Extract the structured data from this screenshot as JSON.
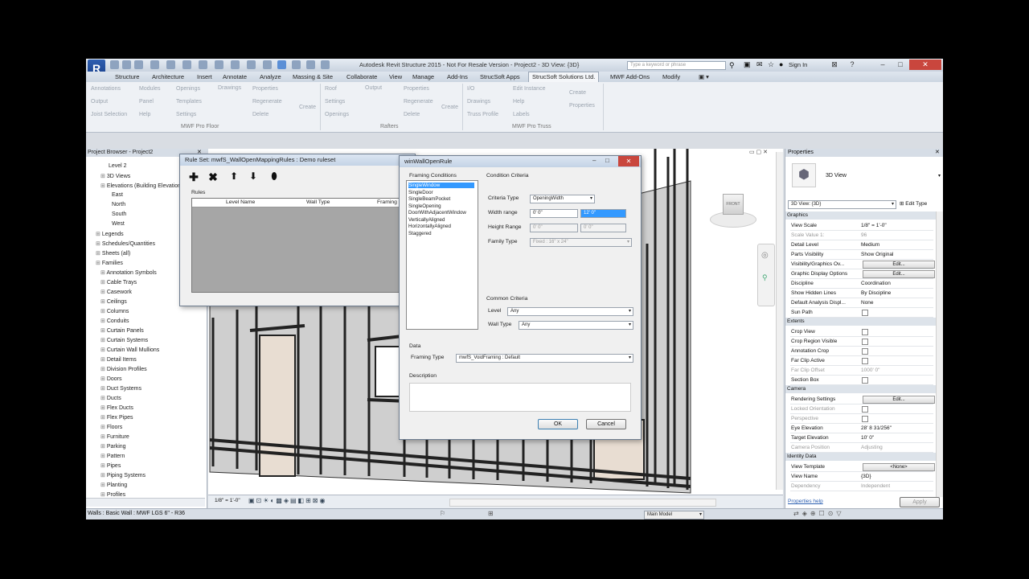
{
  "title_bar": {
    "app_title": "Autodesk Revit Structure 2015 - Not For Resale Version -   Project2 - 3D View: {3D}",
    "search_placeholder": "Type a keyword or phrase",
    "sign_in": "Sign In"
  },
  "tabs": [
    "Structure",
    "Architecture",
    "Insert",
    "Annotate",
    "Analyze",
    "Massing & Site",
    "Collaborate",
    "View",
    "Manage",
    "Add-Ins",
    "StrucSoft Apps",
    "StrucSoft Solutions Ltd.",
    "MWF Add-Ons",
    "Modify"
  ],
  "active_tab": "StrucSoft Solutions Ltd.",
  "ribbon": {
    "panels": [
      {
        "name": "MWF Pro Floor",
        "items": [
          "Annotations",
          "Modules",
          "Openings",
          "Drawings",
          "Output",
          "Panel",
          "Templates",
          "Joist Selection",
          "Help",
          "Settings",
          "Properties",
          "Regenerate",
          "Delete",
          "Create"
        ]
      },
      {
        "name": "Rafters",
        "items": [
          "Roof",
          "Output",
          "Properties",
          "Settings",
          "Regenerate",
          "Openings",
          "Delete",
          "Create"
        ]
      },
      {
        "name": "MWF Pro Truss",
        "items": [
          "I/O",
          "Edit Instance",
          "Drawings",
          "Help",
          "Truss Profile",
          "Labels",
          "Create",
          "Properties"
        ]
      }
    ]
  },
  "project_browser": {
    "title": "Project Browser - Project2",
    "items": [
      "Level 2",
      "3D Views",
      "Elevations (Building Elevation)",
      "East",
      "North",
      "South",
      "West",
      "Legends",
      "Schedules/Quantities",
      "Sheets (all)",
      "Families",
      "Annotation Symbols",
      "Cable Trays",
      "Casework",
      "Ceilings",
      "Columns",
      "Conduits",
      "Curtain Panels",
      "Curtain Systems",
      "Curtain Wall Mullions",
      "Detail Items",
      "Division Profiles",
      "Doors",
      "Duct Systems",
      "Ducts",
      "Flex Ducts",
      "Flex Pipes",
      "Floors",
      "Furniture",
      "Parking",
      "Pattern",
      "Pipes",
      "Piping Systems",
      "Planting",
      "Profiles"
    ]
  },
  "view": {
    "scale": "1/8\" = 1'-0\"",
    "viewcube_label": "FRONT"
  },
  "status_bar": {
    "text": "Walls : Basic Wall : MWF LGS 6\" - R36",
    "model": "Main Model"
  },
  "properties": {
    "title": "Properties",
    "type_name": "3D View",
    "selector": "3D View: {3D}",
    "edit_type": "Edit Type",
    "groups": [
      {
        "name": "Graphics",
        "rows": [
          [
            "View Scale",
            "1/8\" = 1'-0\""
          ],
          [
            "Scale Value    1:",
            "96"
          ],
          [
            "Detail Level",
            "Medium"
          ],
          [
            "Parts Visibility",
            "Show Original"
          ],
          [
            "Visibility/Graphics Ov...",
            "Edit..."
          ],
          [
            "Graphic Display Options",
            "Edit..."
          ],
          [
            "Discipline",
            "Coordination"
          ],
          [
            "Show Hidden Lines",
            "By Discipline"
          ],
          [
            "Default Analysis Displ...",
            "None"
          ],
          [
            "Sun Path",
            ""
          ]
        ]
      },
      {
        "name": "Extents",
        "rows": [
          [
            "Crop View",
            ""
          ],
          [
            "Crop Region Visible",
            ""
          ],
          [
            "Annotation Crop",
            ""
          ],
          [
            "Far Clip Active",
            ""
          ],
          [
            "Far Clip Offset",
            "1000' 0\""
          ],
          [
            "Section Box",
            ""
          ]
        ]
      },
      {
        "name": "Camera",
        "rows": [
          [
            "Rendering Settings",
            "Edit..."
          ],
          [
            "Locked Orientation",
            ""
          ],
          [
            "Perspective",
            ""
          ],
          [
            "Eye Elevation",
            "28' 8 31/256\""
          ],
          [
            "Target Elevation",
            "10' 0\""
          ],
          [
            "Camera Position",
            "Adjusting"
          ]
        ]
      },
      {
        "name": "Identity Data",
        "rows": [
          [
            "View Template",
            "<None>"
          ],
          [
            "View Name",
            "{3D}"
          ],
          [
            "Dependency",
            "Independent"
          ]
        ]
      }
    ],
    "help": "Properties help",
    "apply": "Apply"
  },
  "rule_set_dialog": {
    "title": "Rule Set: mwfS_WallOpenMappingRules : Demo ruleset",
    "rules_label": "Rules",
    "columns": [
      "Level Name",
      "Wall Type",
      "Framing"
    ]
  },
  "wall_open_rule_dialog": {
    "title": "winWallOpenRule",
    "framing_conditions_label": "Framing Conditions",
    "framing_conditions": [
      "SingleWindow",
      "SingleDoor",
      "SingleBeamPocket",
      "SingleOpening",
      "DoorWithAdjacentWindow",
      "VerticallyAligned",
      "HorizontallyAligned",
      "Staggered"
    ],
    "selected_condition": "SingleWindow",
    "condition_criteria_label": "Condition Criteria",
    "criteria_type_label": "Criteria Type",
    "criteria_type_value": "OpeningWidth",
    "width_range_label": "Width range",
    "width_range_min": "0'  0\"",
    "width_range_max": "12' 0\"",
    "height_range_label": "Height Range",
    "height_range_min": "0'  0\"",
    "height_range_max": "0'  0\"",
    "family_type_label": "Family Type",
    "family_type_value": "Fixed : 16\" x 24\"",
    "common_criteria_label": "Common Criteria",
    "level_label": "Level",
    "level_value": "Any",
    "wall_type_label": "Wall Type",
    "wall_type_value": "Any",
    "data_label": "Data",
    "framing_type_label": "Framing Type",
    "framing_type_value": "mwfS_VoidFraming : Default",
    "description_label": "Description",
    "ok": "OK",
    "cancel": "Cancel"
  }
}
